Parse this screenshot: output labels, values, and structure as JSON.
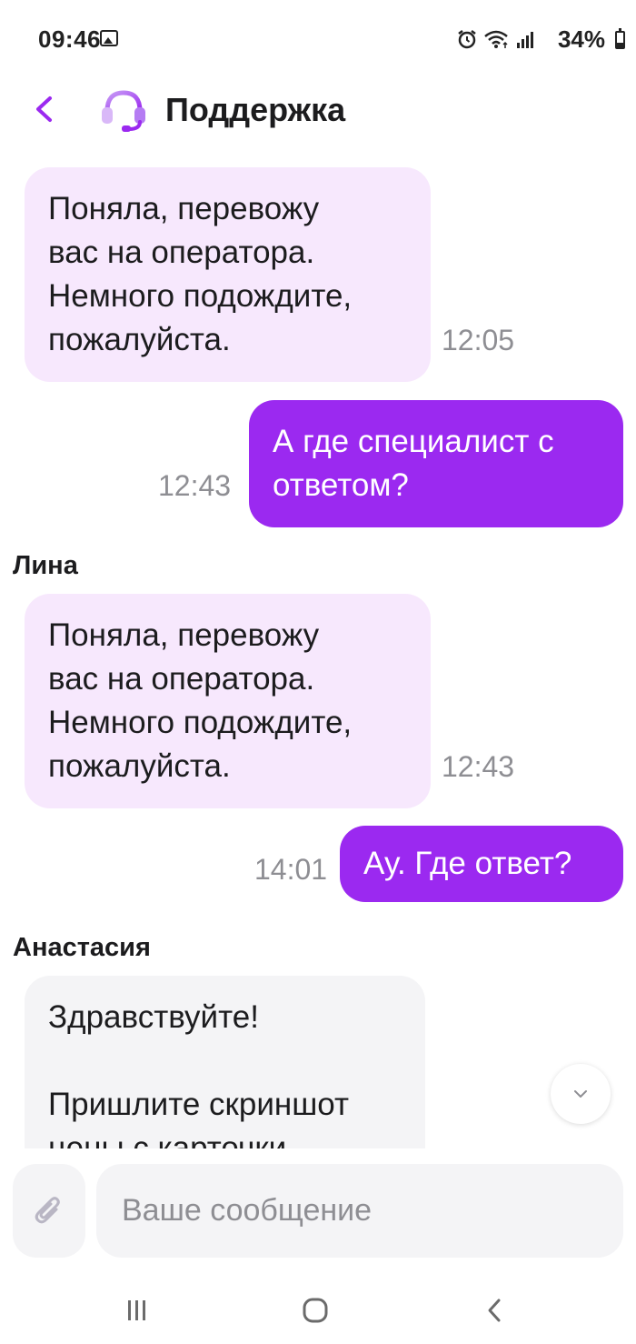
{
  "status_bar": {
    "time": "09:46",
    "battery": "34%"
  },
  "header": {
    "title": "Поддержка",
    "back_icon": "chevron-left-icon",
    "support_icon": "headset-icon",
    "accent_color": "#9b29f0"
  },
  "messages": [
    {
      "direction": "incoming",
      "sender": "",
      "text": [
        "Поняла, перевожу",
        "вас на оператора.",
        "Немного подождите,",
        "пожалуйста."
      ],
      "time": "12:05"
    },
    {
      "direction": "outgoing",
      "text": [
        "А где специалист с",
        "ответом?"
      ],
      "time": "12:43"
    },
    {
      "direction": "incoming",
      "sender": "Лина",
      "text": [
        "Поняла, перевожу",
        "вас на оператора.",
        "Немного подождите,",
        "пожалуйста."
      ],
      "time": "12:43"
    },
    {
      "direction": "outgoing",
      "text": [
        "Ау. Где ответ?"
      ],
      "time": "14:01"
    },
    {
      "direction": "incoming",
      "sender": "Анастасия",
      "text": [
        "Здравствуйте!",
        "",
        "Пришлите скриншот",
        "цены с карточки"
      ],
      "time": ""
    }
  ],
  "composer": {
    "placeholder": "Ваше сообщение",
    "attach_icon": "paperclip-icon"
  },
  "navigation": {
    "recents_icon": "recents-icon",
    "home_icon": "home-icon",
    "back_icon": "back-icon"
  },
  "colors": {
    "incoming_bubble": "#f7e8fd",
    "incoming_bubble_gray": "#f4f4f6",
    "outgoing_bubble": "#9b29f0"
  }
}
